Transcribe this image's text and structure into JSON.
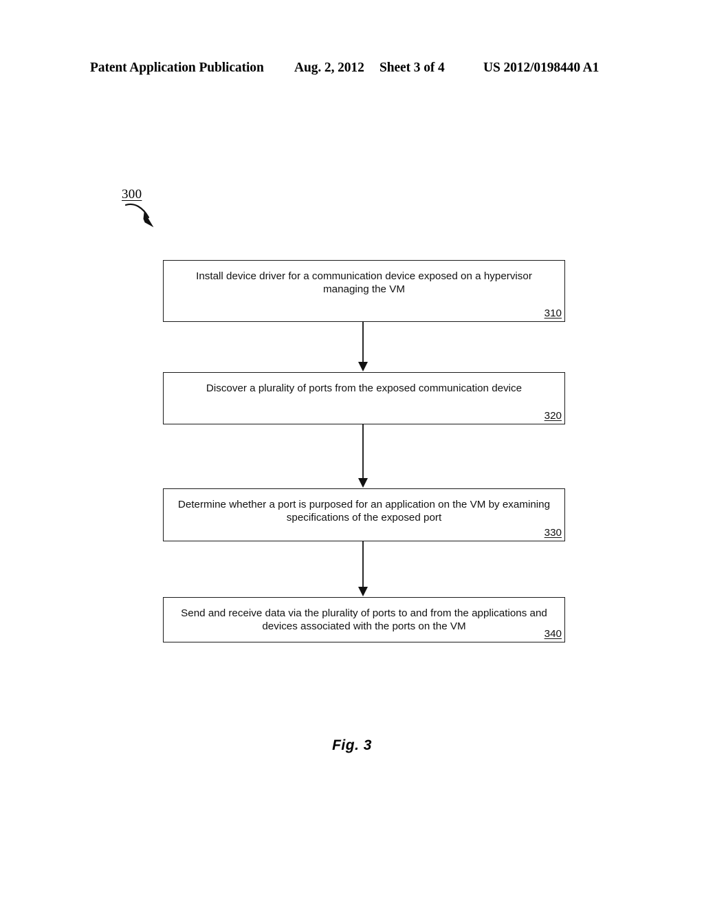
{
  "header": {
    "publication": "Patent Application Publication",
    "date": "Aug. 2, 2012",
    "sheet": "Sheet 3 of 4",
    "patent_number": "US 2012/0198440 A1"
  },
  "figure": {
    "reference_numeral": "300",
    "caption": "Fig. 3",
    "lead_arrow_icon": "curved-arrow-icon"
  },
  "flowchart": {
    "type": "flowchart",
    "orientation": "vertical",
    "steps": [
      {
        "id": "310",
        "text": "Install device driver for a communication device exposed on a hypervisor managing the VM",
        "number": "310"
      },
      {
        "id": "320",
        "text": "Discover a plurality of ports from the exposed communication device",
        "number": "320"
      },
      {
        "id": "330",
        "text": "Determine whether a port is purposed for an application on the VM by examining specifications of the exposed port",
        "number": "330"
      },
      {
        "id": "340",
        "text": "Send and receive data via the plurality of ports to and from the applications and devices associated with the ports on the VM",
        "number": "340"
      }
    ],
    "connectors": [
      {
        "from": "310",
        "to": "320",
        "icon": "down-arrow-icon"
      },
      {
        "from": "320",
        "to": "330",
        "icon": "down-arrow-icon"
      },
      {
        "from": "330",
        "to": "340",
        "icon": "down-arrow-icon"
      }
    ]
  },
  "colors": {
    "ink": "#111111",
    "page": "#ffffff",
    "line": "#1a1a1a"
  }
}
